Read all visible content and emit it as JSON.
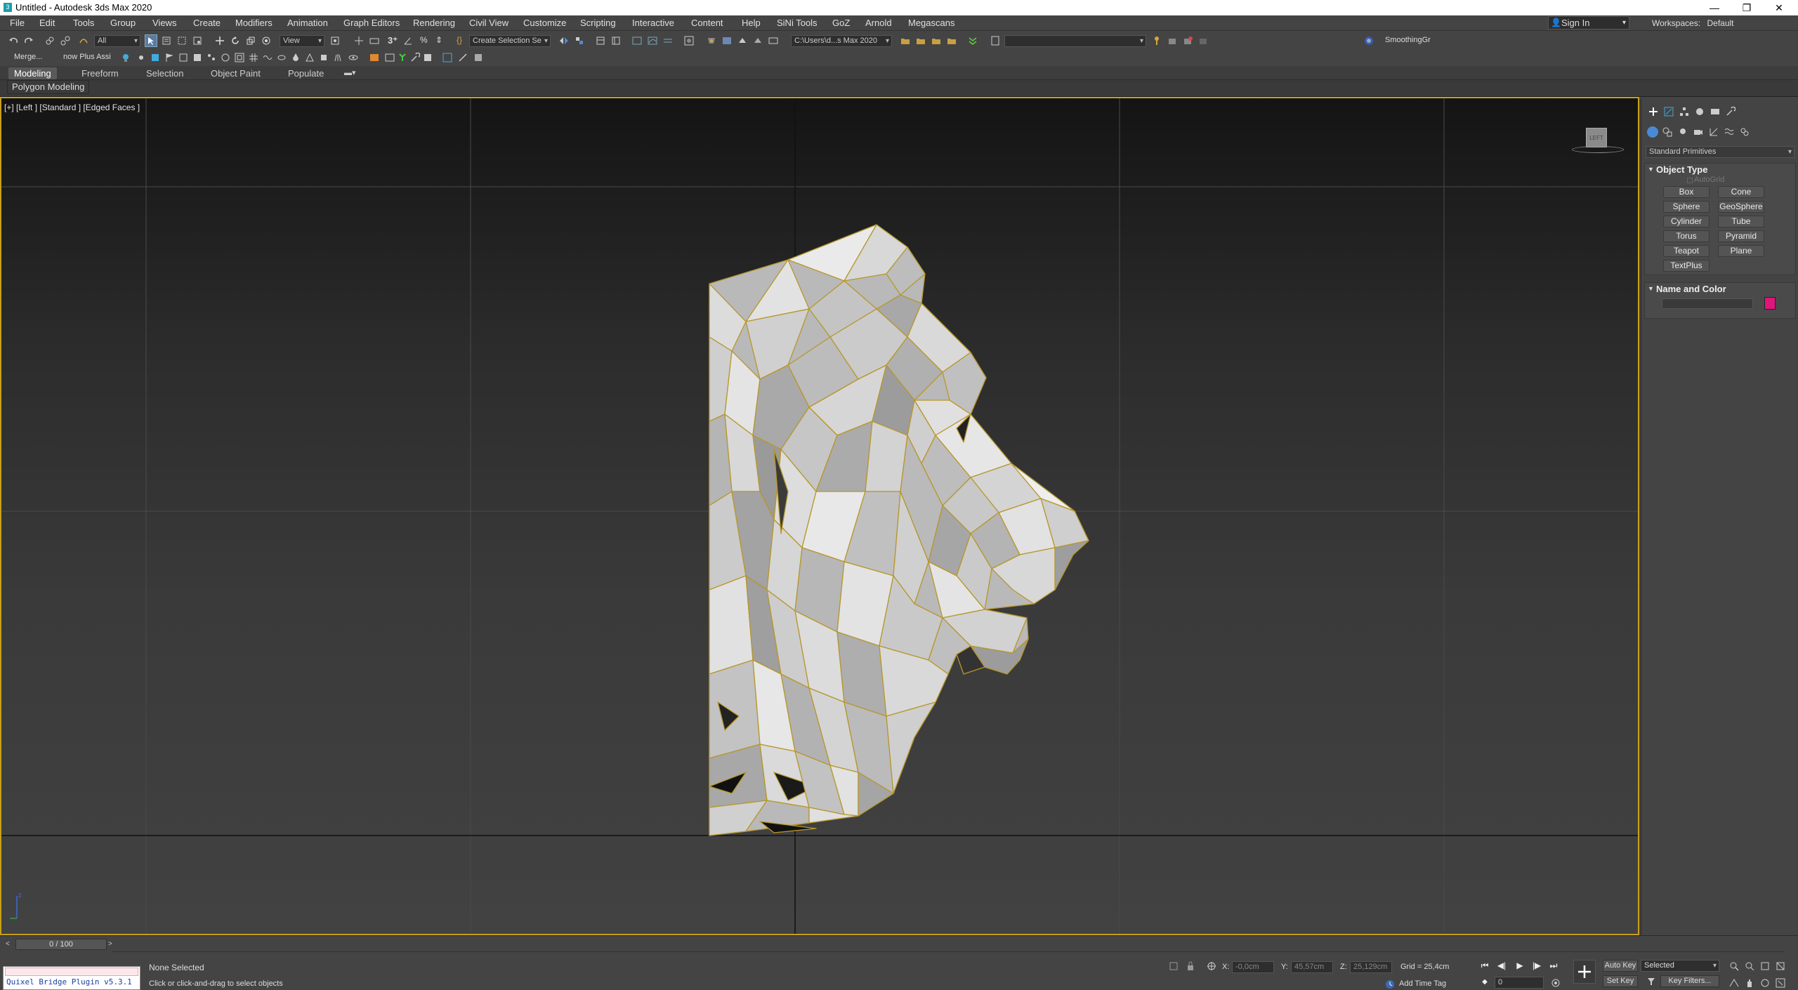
{
  "app": {
    "title": "Untitled - Autodesk 3ds Max 2020",
    "icon_glyph": "3"
  },
  "window_controls": {
    "minimize": "—",
    "restore": "❐",
    "close": "✕"
  },
  "menubar": {
    "items": [
      "File",
      "Edit",
      "Tools",
      "Group",
      "Views",
      "Create",
      "Modifiers",
      "Animation",
      "Graph Editors",
      "Rendering",
      "Civil View",
      "Customize",
      "Scripting",
      "Interactive",
      "Content",
      "Help",
      "SiNi Tools",
      "GoZ",
      "Arnold",
      "Megascans"
    ],
    "sign_in": "Sign In",
    "workspaces_label": "Workspaces:",
    "workspaces_value": "Default"
  },
  "main_toolbar": {
    "selection_filter": "All",
    "ref_coord": "View",
    "named_selection": "Create Selection Se",
    "project_path": "C:\\Users\\d...s Max 2020",
    "smoothing_label": "SmoothingGr"
  },
  "second_toolbar": {
    "merge_label": "Merge...",
    "plugin_label": "now Plus Assi"
  },
  "ribbon": {
    "tabs": [
      "Modeling",
      "Freeform",
      "Selection",
      "Object Paint",
      "Populate"
    ],
    "active_tab": "Modeling",
    "panel_label": "Polygon Modeling"
  },
  "viewport": {
    "label": "[+] [Left ] [Standard ] [Edged Faces ]",
    "viewcube_label": "LEFT"
  },
  "command_panel": {
    "category": "Standard Primitives",
    "object_type_header": "Object Type",
    "autogrid_label": "AutoGrid",
    "buttons": [
      "Box",
      "Cone",
      "Sphere",
      "GeoSphere",
      "Cylinder",
      "Tube",
      "Torus",
      "Pyramid",
      "Teapot",
      "Plane",
      "TextPlus"
    ],
    "name_color_header": "Name and Color",
    "object_color": "#e0157a"
  },
  "bottom": {
    "time_slider": "0 / 100",
    "status_selected": "None Selected",
    "status_prompt": "Click or click-and-drag to select objects",
    "plugin_text": "Quixel Bridge Plugin v5.3.1",
    "x_label": "X:",
    "x_value": "-0,0cm",
    "y_label": "Y:",
    "y_value": "45,57cm",
    "z_label": "Z:",
    "z_value": "25,129cm",
    "grid": "Grid = 25,4cm",
    "add_time_tag": "Add Time Tag",
    "auto_key": "Auto Key",
    "set_key": "Set Key",
    "selected_mode": "Selected",
    "key_filters": "Key Filters...",
    "frame_value": "0"
  }
}
